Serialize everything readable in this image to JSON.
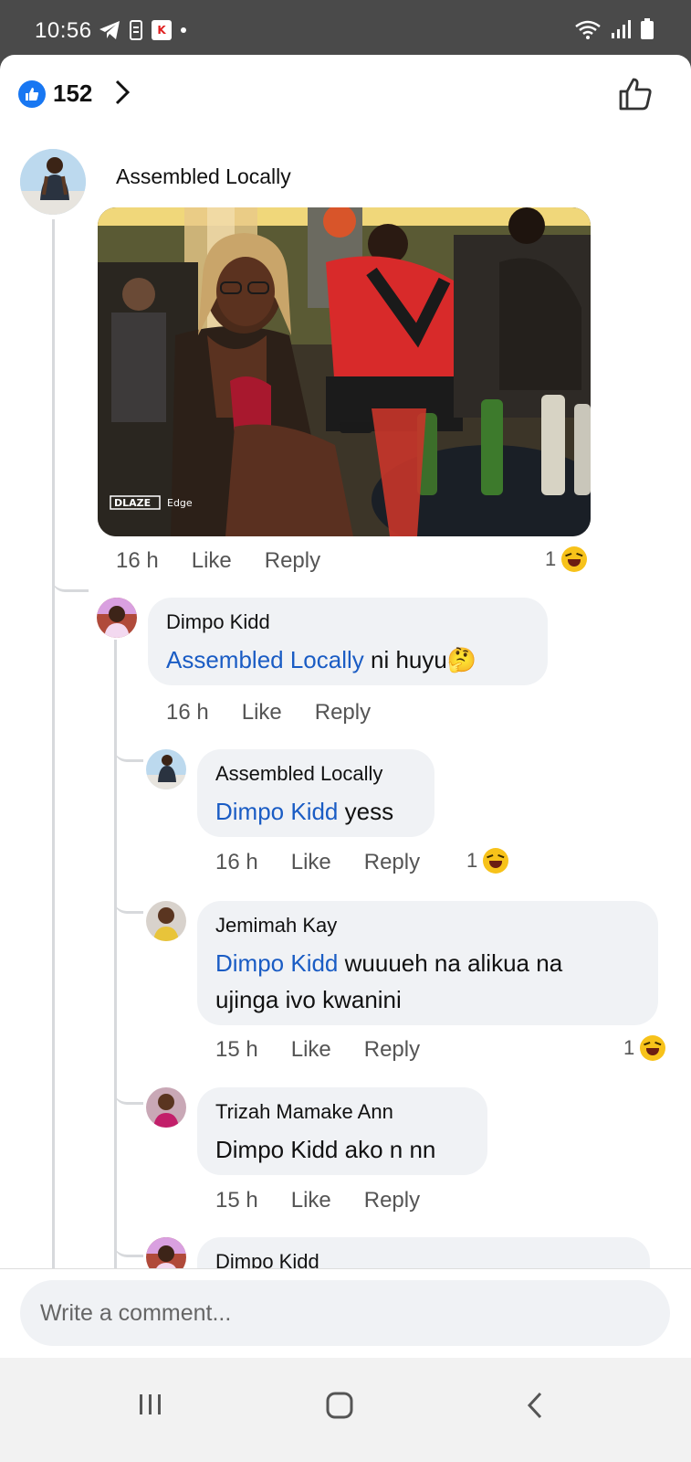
{
  "status_bar": {
    "time": "10:56",
    "icons": [
      "telegram-icon",
      "sim-icon",
      "shop-icon",
      "dot-icon",
      "wifi-icon",
      "signal-icon",
      "battery-icon"
    ]
  },
  "header": {
    "like_count": "152"
  },
  "comments": [
    {
      "author": "Assembled Locally",
      "has_photo": true,
      "photo_watermark": "DLAZE Edge",
      "time": "16 h",
      "like_label": "Like",
      "reply_label": "Reply",
      "reaction_count": "1"
    }
  ],
  "replies": [
    {
      "author": "Dimpo Kidd",
      "mention": "Assembled Locally",
      "text": " ni huyu🤔",
      "time": "16 h",
      "like_label": "Like",
      "reply_label": "Reply"
    },
    {
      "author": "Assembled Locally",
      "mention": "Dimpo Kidd",
      "text": " yess",
      "time": "16 h",
      "like_label": "Like",
      "reply_label": "Reply",
      "reaction_count": "1"
    },
    {
      "author": "Jemimah Kay",
      "mention": "Dimpo Kidd",
      "text_line1": " wuuueh na alikua na",
      "text_line2": "ujinga ivo kwanini",
      "time": "15 h",
      "like_label": "Like",
      "reply_label": "Reply",
      "reaction_count": "1"
    },
    {
      "author": "Trizah Mamake Ann",
      "text": "Dimpo Kidd ako n nn",
      "time": "15 h",
      "like_label": "Like",
      "reply_label": "Reply"
    },
    {
      "author": "Dimpo Kidd"
    }
  ],
  "composer": {
    "placeholder": "Write a comment..."
  },
  "colors": {
    "accent": "#1877f2",
    "mention": "#1a5cc4",
    "bubble": "#f0f2f5",
    "status_bar": "#4a4a4a"
  }
}
